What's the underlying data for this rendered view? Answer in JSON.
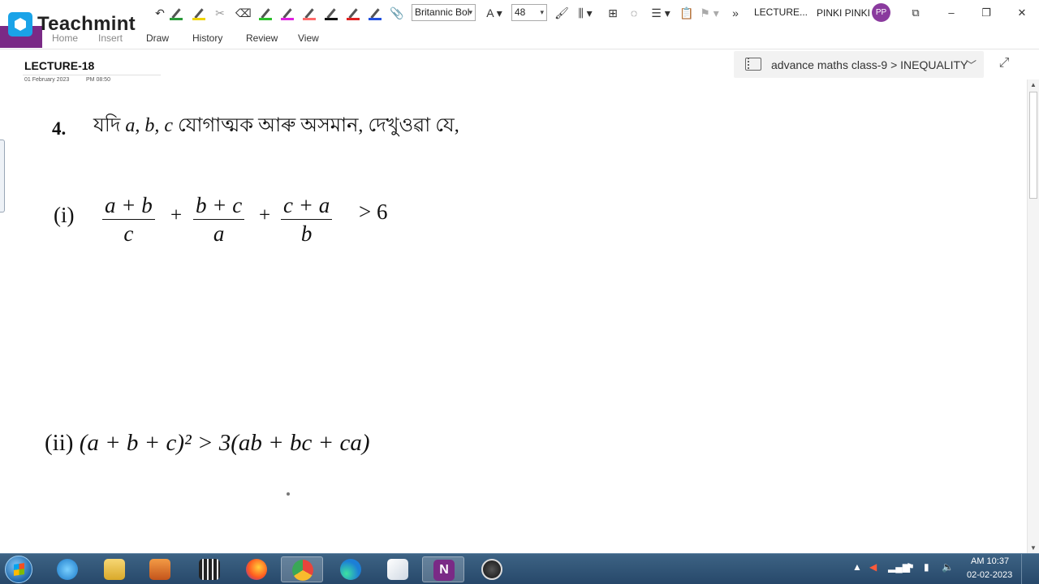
{
  "app": {
    "logo_text": "Teachmint",
    "lecture_title": "LECTURE...",
    "user_name": "PINKI PINKI",
    "user_initials": "PP",
    "overflow_label": "»"
  },
  "toolbar": {
    "font_name": "Britannic Bol",
    "font_size": "48"
  },
  "menu": {
    "items": [
      "Home",
      "Insert",
      "Draw",
      "History",
      "Review",
      "View"
    ]
  },
  "page": {
    "title": "LECTURE-18",
    "date": "01 February 2023",
    "time": "PM 08:50"
  },
  "breadcrumb": {
    "text": "advance maths class-9 > INEQUALITY"
  },
  "content": {
    "question_number": "4.",
    "question_prefix": "যদি",
    "question_vars": "a, b, c",
    "question_suffix": "যোগাত্মক আৰু অসমান, দেখুওৱা যে,",
    "part_i_label": "(i)",
    "frac1_num": "a + b",
    "frac1_den": "c",
    "frac2_num": "b + c",
    "frac2_den": "a",
    "frac3_num": "c + a",
    "frac3_den": "b",
    "plus_sign": "+",
    "part_i_rhs": "> 6",
    "part_ii_label": "(ii)",
    "part_ii_expr": "(a + b + c)² > 3(ab + bc + ca)"
  },
  "taskbar": {
    "time": "AM 10:37",
    "date": "02-02-2023",
    "apps": [
      "internet-explorer",
      "file-explorer",
      "media-player",
      "video-editor",
      "firefox",
      "chrome",
      "edge",
      "sticky-note",
      "onenote",
      "obs"
    ]
  },
  "colors": {
    "accent": "#7a2a86",
    "logo_blue": "#1aa3e8",
    "taskbar": "#2c4f73"
  }
}
